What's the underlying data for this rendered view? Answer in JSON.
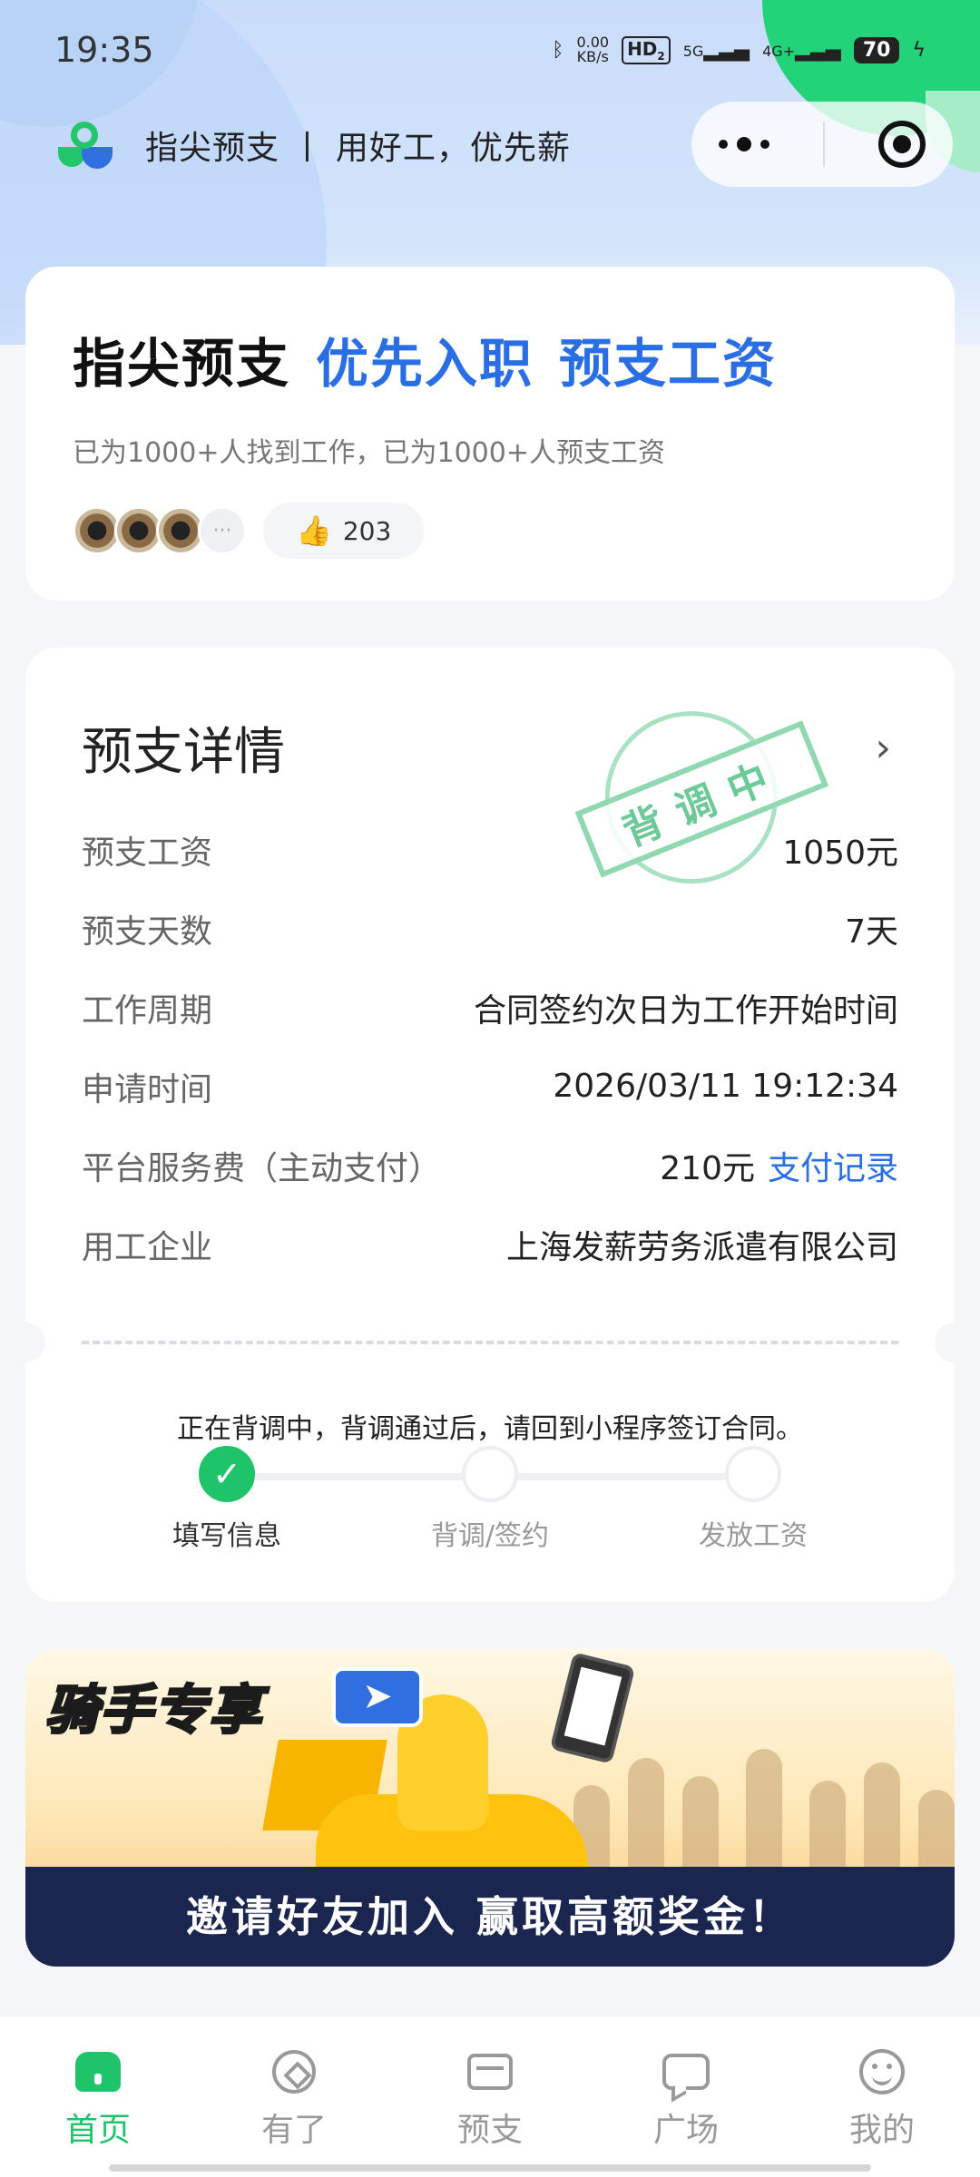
{
  "status": {
    "time": "19:35",
    "net_speed": "0.00",
    "net_unit": "KB/s",
    "hd": "HD",
    "sim": "2",
    "net1": "5G",
    "net2": "4G+",
    "battery": "70"
  },
  "nav": {
    "title": "指尖预支 丨 用好工，优先薪"
  },
  "hero": {
    "title_black": "指尖预支",
    "title_blue_1": "优先入职",
    "title_blue_2": "预支工资",
    "subtitle": "已为1000+人找到工作，已为1000+人预支工资",
    "more": "···",
    "likes": "203"
  },
  "detail": {
    "title": "预支详情",
    "stamp": "背调中",
    "rows": [
      {
        "label": "预支工资",
        "value": "1050元"
      },
      {
        "label": "预支天数",
        "value": "7天"
      },
      {
        "label": "工作周期",
        "value": "合同签约次日为工作开始时间"
      },
      {
        "label": "申请时间",
        "value": "2026/03/11 19:12:34"
      },
      {
        "label": "平台服务费（主动支付）",
        "value": "210元",
        "link": "支付记录"
      },
      {
        "label": "用工企业",
        "value": "上海发薪劳务派遣有限公司"
      }
    ],
    "notice": "正在背调中，背调通过后，请回到小程序签订合同。",
    "steps": [
      {
        "label": "填写信息",
        "done": true
      },
      {
        "label": "背调/签约",
        "done": false
      },
      {
        "label": "发放工资",
        "done": false
      }
    ]
  },
  "banner": {
    "title": "骑手专享",
    "bottom": "邀请好友加入 赢取高额奖金！"
  },
  "tabs": [
    {
      "label": "首页",
      "icon": "home-icon",
      "active": true
    },
    {
      "label": "有了",
      "icon": "compass-icon"
    },
    {
      "label": "预支",
      "icon": "wallet-icon"
    },
    {
      "label": "广场",
      "icon": "chat-icon"
    },
    {
      "label": "我的",
      "icon": "smile-icon"
    }
  ],
  "colors": {
    "accent_green": "#1fc46a",
    "accent_blue": "#2a6ee6"
  }
}
